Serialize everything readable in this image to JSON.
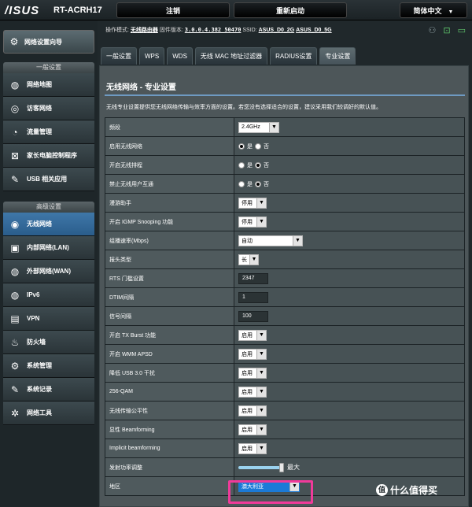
{
  "header": {
    "logo": "/ISUS",
    "model": "RT-ACRH17",
    "logout": "注销",
    "reboot": "重新启动",
    "language": "简体中文"
  },
  "status": {
    "mode_label": "操作模式:",
    "mode_value": "无线路由器",
    "fw_label": "固件版本:",
    "fw_value": "3.0.0.4.382_50470",
    "ssid_label": "SSID:",
    "ssid_2g": "ASUS_D0_2G",
    "ssid_5g": "ASUS_D0_5G"
  },
  "sidebar": {
    "quick_setup": "网络设置向导",
    "general_header": "一般设置",
    "general_items": [
      "网络地图",
      "访客网络",
      "流量管理",
      "家长电脑控制程序",
      "USB 相关应用"
    ],
    "advanced_header": "高级设置",
    "advanced_items": [
      "无线网络",
      "内部网络(LAN)",
      "外部网络(WAN)",
      "IPv6",
      "VPN",
      "防火墙",
      "系统管理",
      "系统记录",
      "网络工具"
    ]
  },
  "tabs": [
    "一般设置",
    "WPS",
    "WDS",
    "无线 MAC 地址过滤器",
    "RADIUS设置",
    "专业设置"
  ],
  "panel": {
    "title": "无线网络 - 专业设置",
    "description": "无线专业设置提供您无线网络传输与效率方面的设置。若您没有选择适合的设置，建议采用我们较调好的默认值。"
  },
  "radio": {
    "yes": "是",
    "no": "否"
  },
  "settings": {
    "band": {
      "label": "频段",
      "value": "2.4GHz"
    },
    "enable_radio": {
      "label": "启用无线网络",
      "value": "是"
    },
    "radio_schedule": {
      "label": "开启无线排程",
      "value": "否"
    },
    "ap_isolation": {
      "label": "禁止无线用户互通",
      "value": "否"
    },
    "roaming_assistant": {
      "label": "漫游助手",
      "value": "停用"
    },
    "igmp_snooping": {
      "label": "开启 IGMP Snooping 功能",
      "value": "停用"
    },
    "multicast_rate": {
      "label": "组播速率(Mbps)",
      "value": "自动"
    },
    "preamble": {
      "label": "报头类型",
      "value": "长"
    },
    "rts": {
      "label": "RTS 门槛设置",
      "value": "2347"
    },
    "dtim": {
      "label": "DTIM间隔",
      "value": "1"
    },
    "beacon": {
      "label": "信号间隔",
      "value": "100"
    },
    "tx_burst": {
      "label": "开启 TX Burst 功能",
      "value": "启用"
    },
    "wmm_apsd": {
      "label": "开启 WMM APSD",
      "value": "启用"
    },
    "usb3_interference": {
      "label": "降低 USB 3.0 干扰",
      "value": "启用"
    },
    "qam256": {
      "label": "256-QAM",
      "value": "启用"
    },
    "airtime_fairness": {
      "label": "无线传输公平性",
      "value": "启用"
    },
    "explicit_bf": {
      "label": "显性 Beamforming",
      "value": "启用"
    },
    "implicit_bf": {
      "label": "Implicit beamforming",
      "value": "启用"
    },
    "tx_power": {
      "label": "发射功率调整",
      "value": "最大",
      "level": 1.0
    },
    "region": {
      "label": "地区",
      "value": "澳大利亚"
    }
  },
  "watermark": "什么值得买",
  "colors": {
    "active_menu": "#2f6a9e",
    "highlight": "#f03a9a",
    "region_select": "#1b7ad7"
  }
}
